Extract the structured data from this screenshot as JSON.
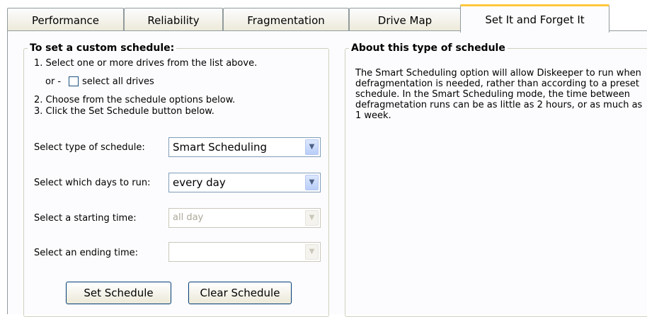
{
  "tabs": [
    "Performance",
    "Reliability",
    "Fragmentation",
    "Drive Map",
    "Set It and Forget It"
  ],
  "custom": {
    "title": "To set a custom schedule:",
    "step1": "1. Select one or more drives from the list above.",
    "or_label": "or -",
    "select_all_label": "select all drives",
    "step2": "2. Choose from the schedule options below.",
    "step3": "3. Click the Set Schedule button below."
  },
  "fields": {
    "type_label": "Select type of schedule:",
    "type_value": "Smart Scheduling",
    "days_label": "Select which days to run:",
    "days_value": "every day",
    "start_label": "Select a starting time:",
    "start_value": "all day",
    "end_label": "Select an ending time:",
    "end_value": ""
  },
  "buttons": {
    "set": "Set Schedule",
    "clear": "Clear Schedule"
  },
  "about": {
    "title": "About this type of schedule",
    "body": "The Smart Scheduling option will allow Diskeeper to run when defragmentation is needed, rather than according to a preset schedule.  In the Smart Scheduling mode, the time between defragmetation runs can be as little as 2 hours, or as much as 1 week."
  },
  "colors": {
    "tab_highlight": "#ffc83c",
    "border": "#919b9c"
  },
  "icons": {
    "dropdown": "chevron-down-icon"
  }
}
